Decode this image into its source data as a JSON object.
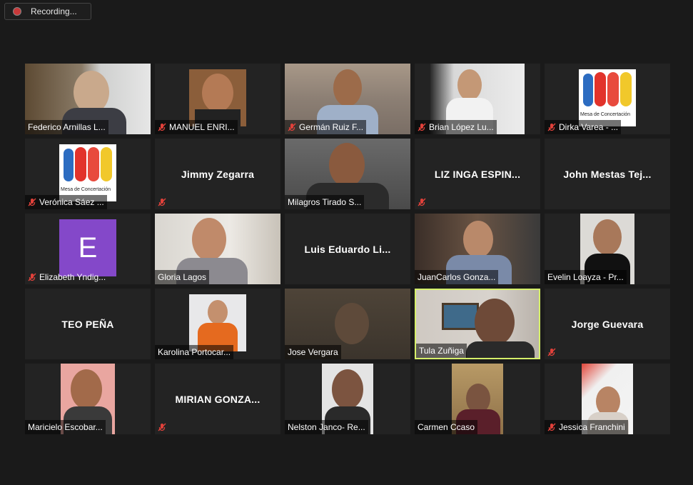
{
  "recording": {
    "label": "Recording..."
  },
  "participants": [
    {
      "name": "Federico Arnillas L...",
      "muted": false
    },
    {
      "name": "MANUEL ENRI...",
      "muted": true
    },
    {
      "name": "Germán Ruiz F...",
      "muted": true
    },
    {
      "name": "Brian López Lu...",
      "muted": true
    },
    {
      "name": "Dirka Varea - ...",
      "muted": true
    },
    {
      "name": "Verónica Sáez ...",
      "muted": true
    },
    {
      "name": "Jimmy Zegarra",
      "muted": true
    },
    {
      "name": "Milagros Tirado S...",
      "muted": false
    },
    {
      "name": "LIZ INGA ESPIN...",
      "muted": true
    },
    {
      "name": "John Mestas Tej...",
      "muted": false
    },
    {
      "name": "Elizabeth Yndig...",
      "muted": true,
      "avatar_letter": "E"
    },
    {
      "name": "Gloria Lagos",
      "muted": false
    },
    {
      "name": "Luis Eduardo Li...",
      "muted": false
    },
    {
      "name": "JuanCarlos Gonza...",
      "muted": false
    },
    {
      "name": "Evelin Loayza - Pr...",
      "muted": false
    },
    {
      "name": "TEO PEÑA",
      "muted": false
    },
    {
      "name": "Karolina Portocar...",
      "muted": false
    },
    {
      "name": "Jose Vergara",
      "muted": false
    },
    {
      "name": "Tula Zuñiga",
      "muted": false,
      "active_speaker": true
    },
    {
      "name": "Jorge Guevara",
      "muted": true
    },
    {
      "name": "Maricielo Escobar...",
      "muted": false
    },
    {
      "name": "MIRIAN GONZA...",
      "muted": true
    },
    {
      "name": "Nelston Janco- Re...",
      "muted": false
    },
    {
      "name": "Carmen Ccaso",
      "muted": false
    },
    {
      "name": "Jessica Franchini",
      "muted": true
    }
  ],
  "logo": {
    "text": "Mesa de Concertación"
  },
  "colors": {
    "background": "#1a1a1a",
    "tile": "#232323",
    "active_border": "#d6f06a",
    "muted_icon": "#e0413a",
    "avatar": "#8448c9"
  }
}
